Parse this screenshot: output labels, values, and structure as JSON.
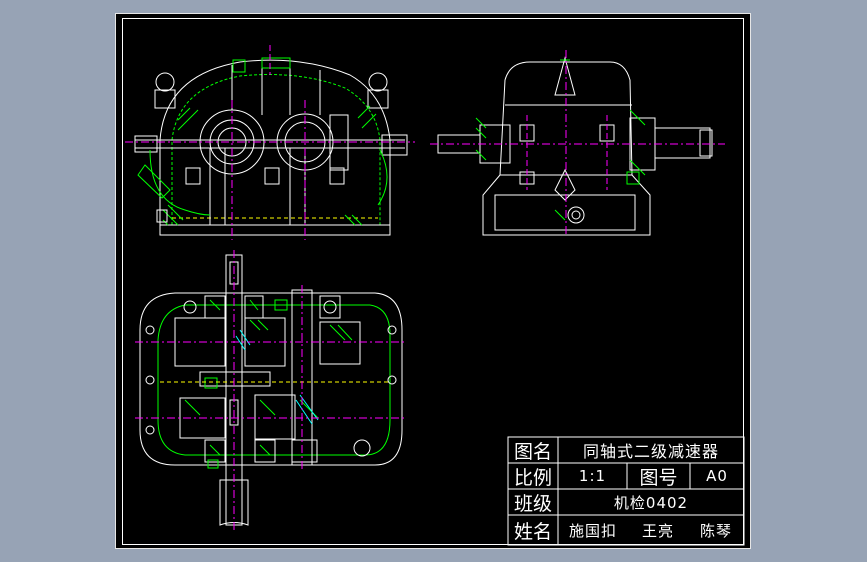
{
  "colors": {
    "background": "#97a3b5",
    "sheet": "#000000",
    "outline": "#ffffff",
    "dimension": "#00ff00",
    "centerline": "#ff00ff",
    "hatch": "#00ff00",
    "detail": "#00ffff"
  },
  "title_block": {
    "drawing_name_label": "图名",
    "drawing_name": "同轴式二级减速器",
    "scale_label": "比例",
    "scale": "1:1",
    "drawing_no_label": "图号",
    "drawing_no": "A0",
    "class_label": "班级",
    "class_name": "机检0402",
    "names_label": "姓名",
    "member_1": "施国扣",
    "member_2": "王亮",
    "member_3": "陈琴"
  }
}
